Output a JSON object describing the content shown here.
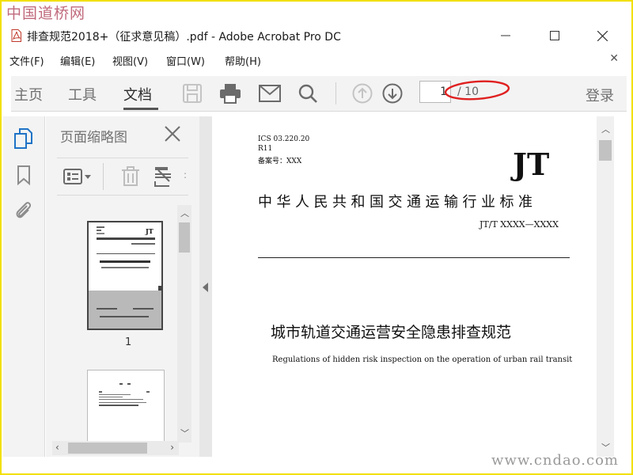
{
  "watermark": {
    "top": "中国道桥网",
    "bottom": "www.cndao.com"
  },
  "window": {
    "title": "排查规范2018+（征求意见稿）.pdf - Adobe Acrobat Pro DC"
  },
  "menu": {
    "items": [
      "文件(F)",
      "编辑(E)",
      "视图(V)",
      "窗口(W)",
      "帮助(H)"
    ]
  },
  "toolbar": {
    "tabs": [
      "主页",
      "工具",
      "文档"
    ],
    "active_tab": "文档",
    "page_current": "1",
    "page_total": "/ 10",
    "login": "登录"
  },
  "sidebar": {
    "title": "页面缩略图",
    "thumb_label": "1"
  },
  "document": {
    "ics": "ICS  03.220.20",
    "class_code": "R11",
    "record": "备案号：XXX",
    "logo": "JT",
    "standard_title": "中华人民共和国交通运输行业标准",
    "standard_code": "JT/T XXXX—XXXX",
    "title_zh": "城市轨道交通运营安全隐患排查规范",
    "title_en": "Regulations of hidden risk inspection on the operation of urban rail transit"
  },
  "colors": {
    "annotation": "#e02020",
    "frame": "#f2e000",
    "accent": "#1f73c6"
  }
}
